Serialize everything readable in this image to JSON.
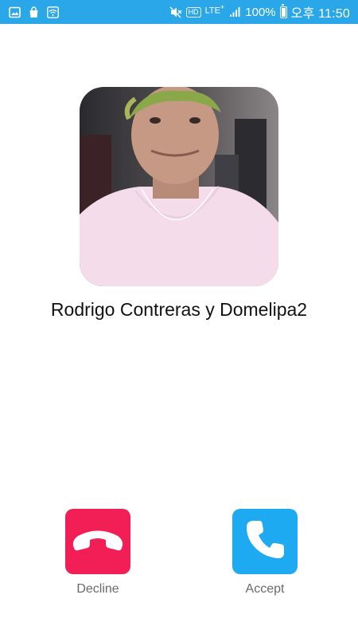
{
  "status_bar": {
    "time": "오후 11:50",
    "battery": "100%",
    "network": "LTE",
    "network_plus": "+",
    "hd": "HD",
    "icons": [
      "image-icon",
      "shopping-bag-icon",
      "wifi-icon",
      "mute-icon",
      "signal-icon",
      "battery-icon"
    ]
  },
  "call": {
    "caller_name": "Rodrigo Contreras y Domelipa2",
    "decline_label": "Decline",
    "accept_label": "Accept"
  },
  "colors": {
    "status_bar": "#2aa7e8",
    "decline": "#f21f57",
    "accept": "#1eaaf1"
  }
}
